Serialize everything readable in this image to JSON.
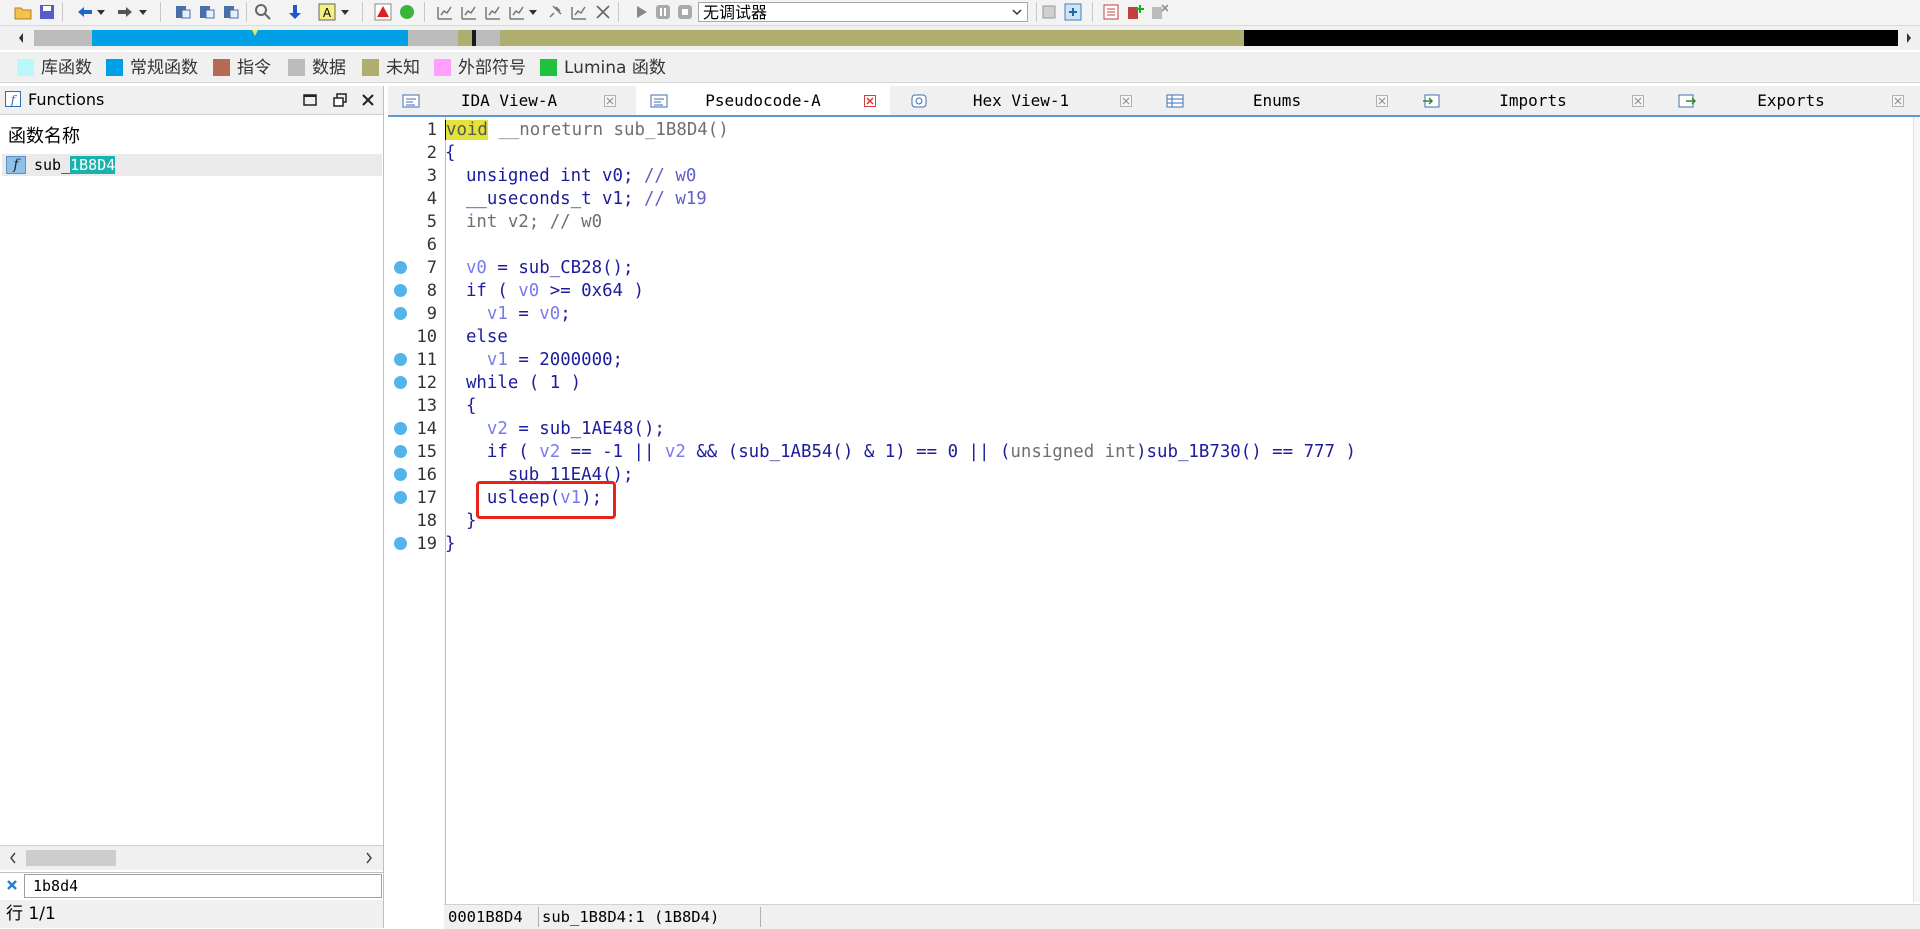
{
  "toolbar": {
    "debugger_select": "无调试器"
  },
  "legend": [
    {
      "label": "库函数",
      "color": "#b8f8f8"
    },
    {
      "label": "常规函数",
      "color": "#00a0e6"
    },
    {
      "label": "指令",
      "color": "#b66a52"
    },
    {
      "label": "数据",
      "color": "#bcbcbc"
    },
    {
      "label": "未知",
      "color": "#b0ae6e"
    },
    {
      "label": "外部符号",
      "color": "#ffa0ff"
    },
    {
      "label": "Lumina 函数",
      "color": "#20c040"
    }
  ],
  "functions_panel": {
    "title": "Functions",
    "column_header": "函数名称",
    "rows": [
      {
        "prefix": "sub_",
        "highlight": "1B8D4"
      }
    ],
    "filter_value": "1b8d4",
    "status": "行 1/1"
  },
  "tabs": [
    {
      "label": "IDA View-A",
      "active": false
    },
    {
      "label": "Pseudocode-A",
      "active": true
    },
    {
      "label": "Hex View-1",
      "active": false
    },
    {
      "label": "Enums",
      "active": false
    },
    {
      "label": "Imports",
      "active": false
    },
    {
      "label": "Exports",
      "active": false
    }
  ],
  "code_lines": [
    {
      "n": "1",
      "bp": false
    },
    {
      "n": "2",
      "bp": false
    },
    {
      "n": "3",
      "bp": false
    },
    {
      "n": "4",
      "bp": false
    },
    {
      "n": "5",
      "bp": false
    },
    {
      "n": "6",
      "bp": false
    },
    {
      "n": "7",
      "bp": true
    },
    {
      "n": "8",
      "bp": true
    },
    {
      "n": "9",
      "bp": true
    },
    {
      "n": "10",
      "bp": false
    },
    {
      "n": "11",
      "bp": true
    },
    {
      "n": "12",
      "bp": true
    },
    {
      "n": "13",
      "bp": false
    },
    {
      "n": "14",
      "bp": true
    },
    {
      "n": "15",
      "bp": true
    },
    {
      "n": "16",
      "bp": true
    },
    {
      "n": "17",
      "bp": true
    },
    {
      "n": "18",
      "bp": false
    },
    {
      "n": "19",
      "bp": true
    }
  ],
  "code": {
    "l1_void": "void",
    "l1_rest": " __noreturn sub_1B8D4()",
    "l2": "{",
    "l3_a": "  unsigned int v0; ",
    "l3_c": "// w0",
    "l4_a": "  __useconds_t v1; ",
    "l4_c": "// w19",
    "l5": "  int v2; // w0",
    "l7_a": "  ",
    "l7_v": "v0",
    "l7_b": " = sub_CB28();",
    "l8_a": "  if ( ",
    "l8_v": "v0",
    "l8_b": " >= 0x64 )",
    "l9_a": "    ",
    "l9_v1": "v1",
    "l9_b": " = ",
    "l9_v0": "v0",
    "l9_c": ";",
    "l10": "  else",
    "l11_a": "    ",
    "l11_v": "v1",
    "l11_b": " = 2000000;",
    "l12": "  while ( 1 )",
    "l13": "  {",
    "l14_a": "    ",
    "l14_v": "v2",
    "l14_b": " = sub_1AE48();",
    "l15_a": "    if ( ",
    "l15_v": "v2",
    "l15_b": " == -1 || ",
    "l15_v2": "v2",
    "l15_c": " && (sub_1AB54() & 1) == 0 || (",
    "l15_cast": "unsigned int",
    "l15_d": ")sub_1B730() == 777 )",
    "l16": "      sub_11EA4();",
    "l17_a": "    usleep(",
    "l17_v": "v1",
    "l17_b": ");",
    "l18": "  }",
    "l19": "}"
  },
  "status": {
    "address": "0001B8D4",
    "location": "sub_1B8D4:1 (1B8D4)"
  }
}
